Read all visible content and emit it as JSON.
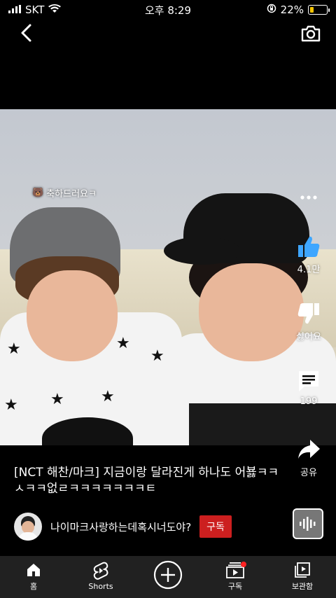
{
  "status_bar": {
    "carrier": "SKT",
    "time": "오후 8:29",
    "battery_percent": "22%",
    "battery_level": 0.22
  },
  "video": {
    "sticker_text": "축하드러요ㅋ",
    "sticker_emoji": "🐻"
  },
  "actions": {
    "like_count": "4.1만",
    "dislike_label": "싫어요",
    "comment_count": "199",
    "share_label": "공유"
  },
  "title": "[NCT 해찬/마크] 지금이랑 달라진게 하나도 어뵳ㅋㅋㅅㅋㅋ없ㄹㅋㅋㅋㅋㅋㅋㅋㅌ",
  "channel": {
    "name": "나이마크사랑하는데혹시너도야?",
    "subscribe_label": "구독"
  },
  "bottom_nav": {
    "home": "홈",
    "shorts": "Shorts",
    "subscriptions": "구독",
    "library": "보관함"
  },
  "colors": {
    "subscribe_red": "#cc1f1f",
    "like_blue": "#3ea6ff",
    "nav_bg": "#212121"
  }
}
